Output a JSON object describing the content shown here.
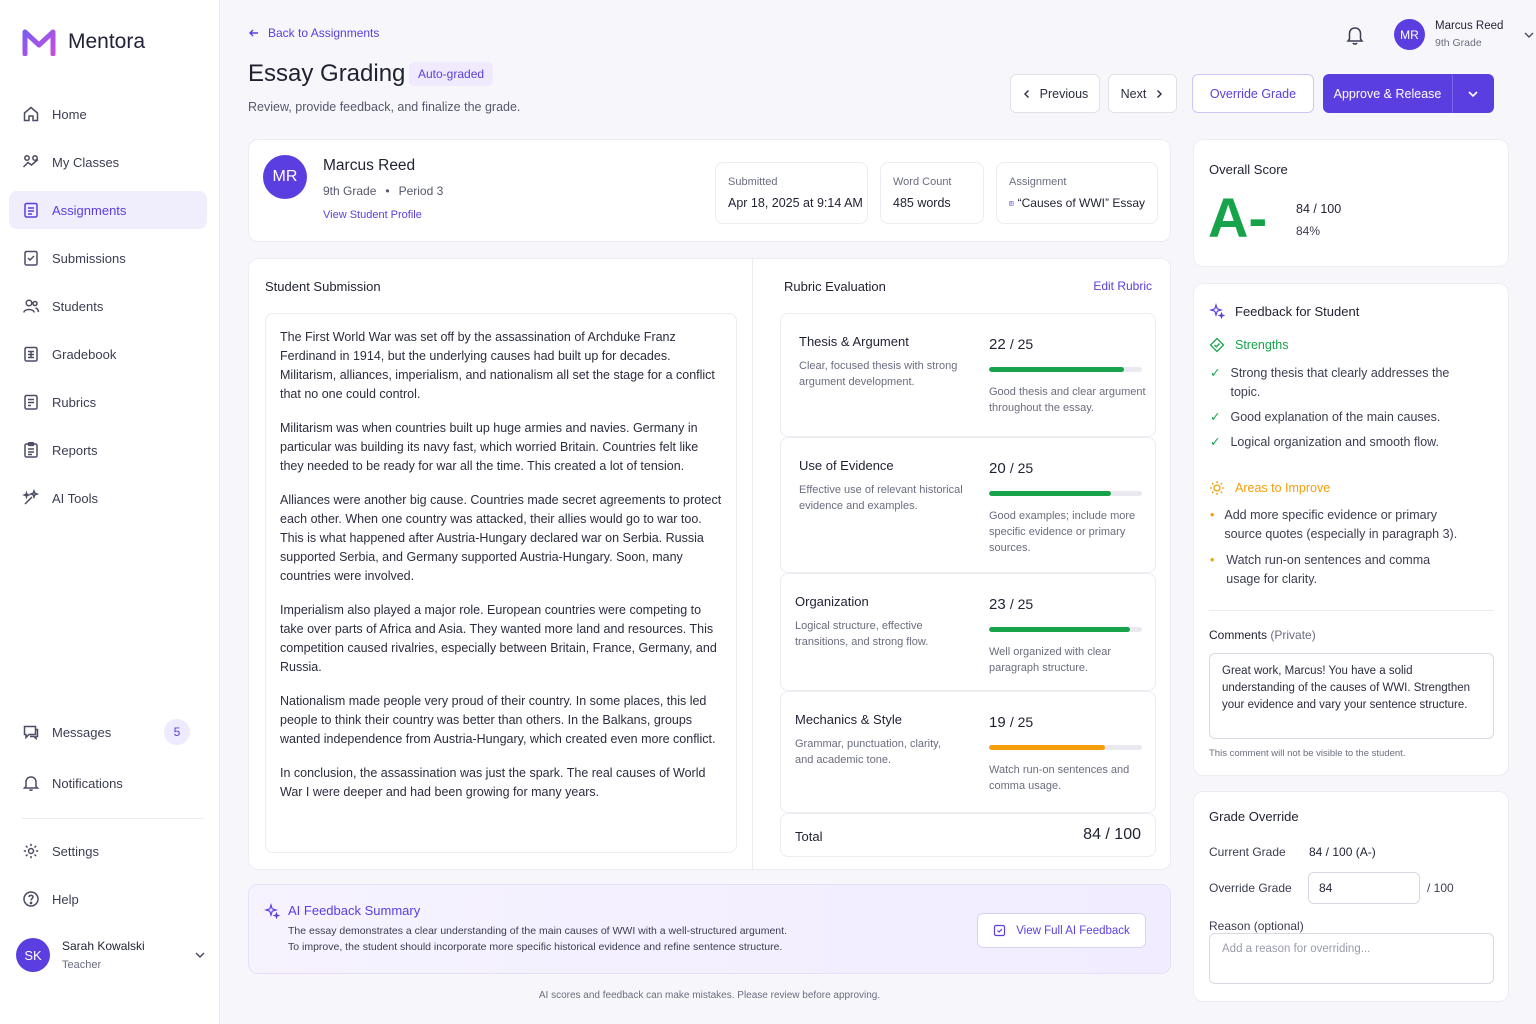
{
  "brand": {
    "name": "Mentora",
    "color": "#5b3ee0"
  },
  "nav": {
    "items": [
      {
        "label": "Home",
        "icon": "home-icon"
      },
      {
        "label": "My Classes",
        "icon": "classes-icon"
      },
      {
        "label": "Assignments",
        "icon": "assignments-icon",
        "active": true
      },
      {
        "label": "Submissions",
        "icon": "submissions-icon"
      },
      {
        "label": "Students",
        "icon": "students-icon"
      },
      {
        "label": "Gradebook",
        "icon": "gradebook-icon"
      },
      {
        "label": "Rubrics",
        "icon": "rubrics-icon"
      },
      {
        "label": "Reports",
        "icon": "reports-icon"
      },
      {
        "label": "AI Tools",
        "icon": "ai-tools-icon"
      }
    ],
    "messages": {
      "label": "Messages",
      "count": "5"
    },
    "notifications": {
      "label": "Notifications"
    },
    "settings": {
      "label": "Settings"
    },
    "help": {
      "label": "Help"
    }
  },
  "sidebar_user": {
    "initials": "SK",
    "name": "Sarah Kowalski",
    "role": "Teacher"
  },
  "top_user": {
    "initials": "MR",
    "name": "Marcus Reed",
    "grade": "9th Grade"
  },
  "header": {
    "back": "Back to Assignments",
    "title": "Essay Grading",
    "tag": "Auto-graded",
    "subtitle": "Review, provide feedback, and finalize the grade.",
    "previous": "Previous",
    "next": "Next",
    "override": "Override Grade",
    "approve": "Approve & Release"
  },
  "student": {
    "initials": "MR",
    "name": "Marcus Reed",
    "grade": "9th Grade",
    "period": "Period 3",
    "profile_link": "View Student Profile",
    "submitted_label": "Submitted",
    "submitted_value": "Apr 18, 2025 at 9:14 AM",
    "wordcount_label": "Word Count",
    "wordcount_value": "485 words",
    "assignment_label": "Assignment",
    "assignment_value": "“Causes of WWI” Essay"
  },
  "submission": {
    "title": "Student Submission",
    "paragraphs": [
      "The First World War was set off by the assassination of Archduke Franz Ferdinand in 1914, but the underlying causes had built up for decades. Militarism, alliances, imperialism, and nationalism all set the stage for a conflict that no one could control.",
      "Militarism was when countries built up huge armies and navies. Germany in particular was building its navy fast, which worried Britain. Countries felt like they needed to be ready for war all the time. This created a lot of tension.",
      "Alliances were another big cause. Countries made secret agreements to protect each other. When one country was attacked, their allies would go to war too. This is what happened after Austria-Hungary declared war on Serbia. Russia supported Serbia, and Germany supported Austria-Hungary. Soon, many countries were involved.",
      "Imperialism also played a major role. European countries were competing to take over parts of Africa and Asia. They wanted more land and resources. This competition caused rivalries, especially between Britain, France, Germany, and Russia.",
      "Nationalism made people very proud of their country. In some places, this led people to think their country was better than others. In the Balkans, groups wanted independence from Austria-Hungary, which created even more conflict.",
      "In conclusion, the assassination was just the spark. The real causes of World War I were deeper and had been growing for many years."
    ]
  },
  "rubric": {
    "title": "Rubric Evaluation",
    "edit": "Edit Rubric",
    "items": [
      {
        "name": "Thesis & Argument",
        "desc": "Clear, focused thesis with strong argument development.",
        "score": "22",
        "max": "25",
        "fraction": 0.88,
        "color": "#16a34a",
        "note": "Good thesis and clear argument throughout the essay."
      },
      {
        "name": "Use of Evidence",
        "desc": "Effective use of relevant historical evidence and examples.",
        "score": "20",
        "max": "25",
        "fraction": 0.8,
        "color": "#16a34a",
        "note": "Good examples; include more specific evidence or primary sources."
      },
      {
        "name": "Organization",
        "desc": "Logical structure, effective transitions, and strong flow.",
        "score": "23",
        "max": "25",
        "fraction": 0.92,
        "color": "#16a34a",
        "note": "Well organized with clear paragraph structure."
      },
      {
        "name": "Mechanics & Style",
        "desc": "Grammar, punctuation, clarity, and academic tone.",
        "score": "19",
        "max": "25",
        "fraction": 0.76,
        "color": "#f59e0b",
        "note": "Watch run-on sentences and comma usage."
      }
    ],
    "total_label": "Total",
    "total_value": "84 / 100"
  },
  "ai_summary": {
    "title": "AI Feedback Summary",
    "line1": "The essay demonstrates a clear understanding of the main causes of WWI with a well-structured argument.",
    "line2": "To improve, the student should incorporate more specific historical evidence and refine sentence structure.",
    "button": "View Full AI Feedback",
    "disclaimer": "AI scores and feedback can make mistakes. Please review before approving."
  },
  "score": {
    "title": "Overall Score",
    "letter": "A-",
    "points": "84 / 100",
    "percent": "84%"
  },
  "feedback": {
    "title": "Feedback for Student",
    "strengths_title": "Strengths",
    "strengths": [
      "Strong thesis that clearly addresses the topic.",
      "Good explanation of the main causes.",
      "Logical organization and smooth flow."
    ],
    "improve_title": "Areas to Improve",
    "improve": [
      "Add more specific evidence or primary source quotes (especially in paragraph 3).",
      "Watch run-on sentences and comma usage for clarity."
    ],
    "comments_label": "Comments",
    "comments_private": "(Private)",
    "comment_text": "Great work, Marcus! You have a solid understanding of the causes of WWI. Strengthen your evidence and vary your sentence structure.",
    "comment_note": "This comment will not be visible to the student."
  },
  "override": {
    "title": "Grade Override",
    "current_label": "Current Grade",
    "current_value": "84 / 100 (A-)",
    "override_label": "Override Grade",
    "override_value": "84",
    "override_suffix": "/ 100",
    "reason_label": "Reason (optional)",
    "reason_placeholder": "Add a reason for overriding..."
  }
}
